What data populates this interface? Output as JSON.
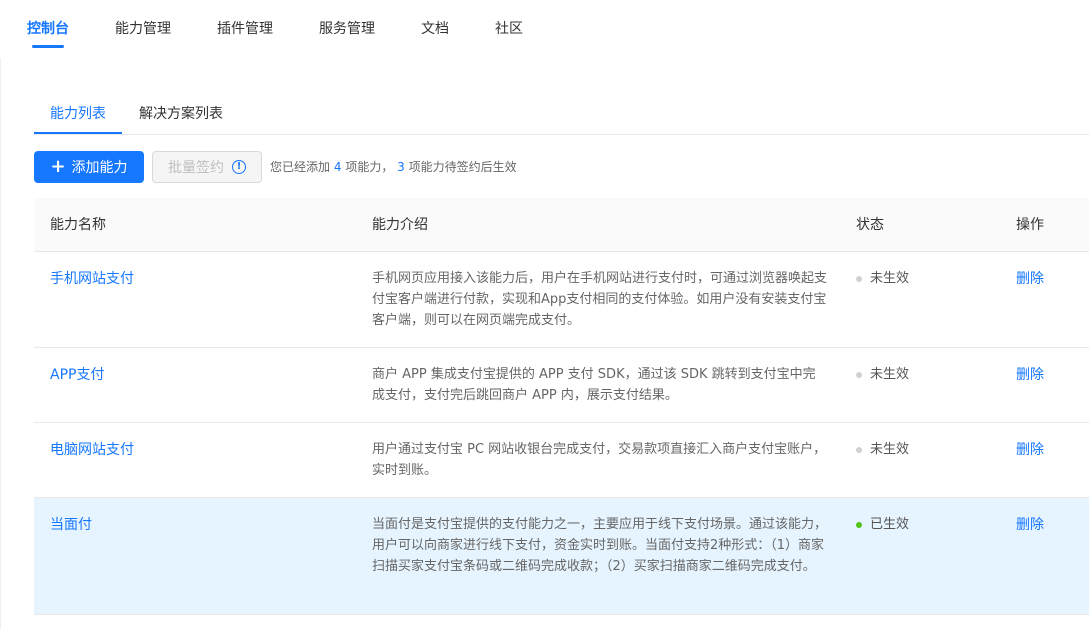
{
  "nav": {
    "items": [
      {
        "label": "控制台",
        "active": true
      },
      {
        "label": "能力管理"
      },
      {
        "label": "插件管理"
      },
      {
        "label": "服务管理"
      },
      {
        "label": "文档"
      },
      {
        "label": "社区"
      }
    ]
  },
  "subtabs": [
    {
      "label": "能力列表",
      "active": true
    },
    {
      "label": "解决方案列表"
    }
  ],
  "toolbar": {
    "add_label": "添加能力",
    "batch_label": "批量签约",
    "summary": {
      "part1": "您已经添加",
      "added_count": "4",
      "part2": "项能力，",
      "pending_count": "3",
      "part3": "项能力待签约后生效"
    }
  },
  "table": {
    "headers": [
      "能力名称",
      "能力介绍",
      "状态",
      "操作"
    ],
    "rows": [
      {
        "name": "手机网站支付",
        "desc": "手机网页应用接入该能力后，用户在手机网站进行支付时，可通过浏览器唤起支付宝客户端进行付款，实现和App支付相同的支付体验。如用户没有安装支付宝客户端，则可以在网页端完成支付。",
        "status": "未生效",
        "action": "删除"
      },
      {
        "name": "APP支付",
        "desc": "商户 APP 集成支付宝提供的 APP 支付 SDK，通过该 SDK 跳转到支付宝中完成支付，支付完后跳回商户 APP 内，展示支付结果。",
        "status": "未生效",
        "action": "删除"
      },
      {
        "name": "电脑网站支付",
        "desc": "用户通过支付宝 PC 网站收银台完成支付，交易款项直接汇入商户支付宝账户，实时到账。",
        "status": "未生效",
        "action": "删除"
      },
      {
        "name": "当面付",
        "desc": "当面付是支付宝提供的支付能力之一，主要应用于线下支付场景。通过该能力，用户可以向商家进行线下支付，资金实时到账。当面付支持2种形式：（1）商家扫描买家支付宝条码或二维码完成收款；（2）买家扫描商家二维码完成支付。",
        "status": "已生效",
        "action": "删除"
      }
    ]
  },
  "colors": {
    "accent": "#1677ff",
    "status_inactive": "#d0d0d0",
    "status_active": "#52c41a",
    "highlight_row": "#e6f4ff"
  },
  "icons": {
    "add": "plus-icon",
    "batch_info": "info-circle-icon",
    "status": "status-dot-icon"
  }
}
